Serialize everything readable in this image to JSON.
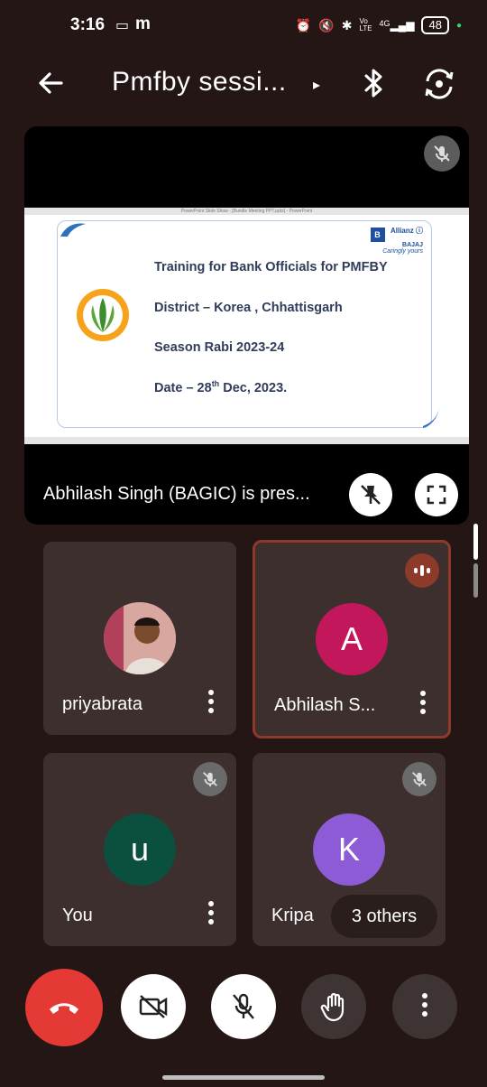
{
  "status_bar": {
    "time": "3:16",
    "app_icon": "m",
    "network": "4G",
    "volte": "Vo LTE",
    "battery": "48"
  },
  "header": {
    "title": "Pmfby  sessi...",
    "title_arrow": "▸"
  },
  "presentation": {
    "presenter_text": "Abhilash Singh (BAGIC) is pres...",
    "slide": {
      "window_caption": "PowerPoint Slide Show - [Bundle Meeting PPT.pptx] - PowerPoint",
      "lines": [
        "Training for Bank Officials for PMFBY",
        "District – Korea , Chhattisgarh",
        "Season Rabi 2023-24"
      ],
      "date_prefix": "Date – 28",
      "date_sup": "th",
      "date_suffix": " Dec, 2023.",
      "brand_letter": "B",
      "brand_name": "Allianz ⓘ",
      "brand_sub": "BAJAJ",
      "brand_tag": "Caringly yours"
    }
  },
  "participants": [
    {
      "name": "priyabrata",
      "initial": ""
    },
    {
      "name": "Abhilash S...",
      "initial": "A",
      "color": "#c2185b"
    },
    {
      "name": "You",
      "initial": "u",
      "color": "#0b4f3f"
    },
    {
      "name": "Kripa",
      "initial": "K",
      "color": "#8e5bd6"
    }
  ],
  "others_chip": "3 others",
  "colors": {
    "end_call": "#e53935",
    "background": "#231615",
    "tile": "#3c2f2e",
    "active_border": "#8d3a2b"
  }
}
